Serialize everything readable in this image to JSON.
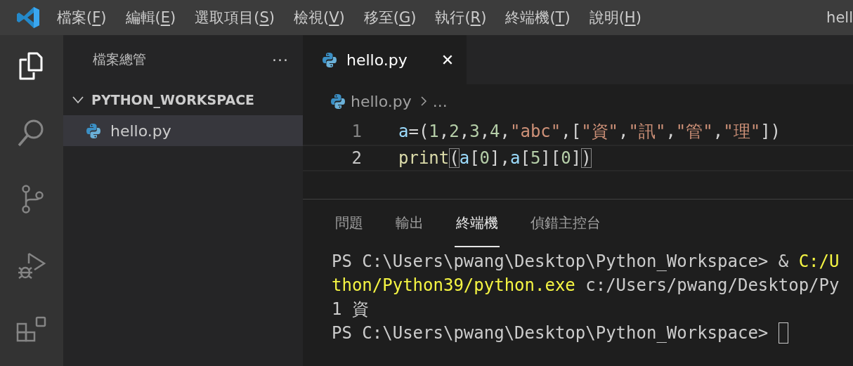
{
  "title_bar": {
    "menu": [
      {
        "before": "檔案(",
        "key": "F",
        "after": ")"
      },
      {
        "before": "編輯(",
        "key": "E",
        "after": ")"
      },
      {
        "before": "選取項目(",
        "key": "S",
        "after": ")"
      },
      {
        "before": "檢視(",
        "key": "V",
        "after": ")"
      },
      {
        "before": "移至(",
        "key": "G",
        "after": ")"
      },
      {
        "before": "執行(",
        "key": "R",
        "after": ")"
      },
      {
        "before": "終端機(",
        "key": "T",
        "after": ")"
      },
      {
        "before": "說明(",
        "key": "H",
        "after": ")"
      }
    ],
    "title": "hell"
  },
  "activity_bar": [
    {
      "kind": "files",
      "selected": true
    },
    {
      "kind": "search",
      "selected": false
    },
    {
      "kind": "source",
      "selected": false
    },
    {
      "kind": "debug",
      "selected": false
    },
    {
      "kind": "extensions",
      "selected": false
    }
  ],
  "sidebar": {
    "title": "檔案總管",
    "more": "···",
    "folder": {
      "name": "PYTHON_WORKSPACE",
      "expanded": true,
      "children": [
        {
          "name": "hello.py",
          "selected": true
        }
      ]
    }
  },
  "editor": {
    "tabs": [
      {
        "label": "hello.py",
        "close": "✕",
        "selected": true
      }
    ],
    "breadcrumb": {
      "file": "hello.py",
      "rest": "..."
    },
    "lines": [
      {
        "number": "1",
        "current": false,
        "tokens": [
          {
            "kind": "var",
            "text": "a"
          },
          {
            "kind": "punc",
            "text": "=("
          },
          {
            "kind": "num",
            "text": "1"
          },
          {
            "kind": "punc",
            "text": ","
          },
          {
            "kind": "num",
            "text": "2"
          },
          {
            "kind": "punc",
            "text": ","
          },
          {
            "kind": "num",
            "text": "3"
          },
          {
            "kind": "punc",
            "text": ","
          },
          {
            "kind": "num",
            "text": "4"
          },
          {
            "kind": "punc",
            "text": ","
          },
          {
            "kind": "str",
            "text": "\"abc\""
          },
          {
            "kind": "punc",
            "text": ",["
          },
          {
            "kind": "str",
            "text": "\"資\""
          },
          {
            "kind": "punc",
            "text": ","
          },
          {
            "kind": "str",
            "text": "\"訊\""
          },
          {
            "kind": "punc",
            "text": ","
          },
          {
            "kind": "str",
            "text": "\"管\""
          },
          {
            "kind": "punc",
            "text": ","
          },
          {
            "kind": "str",
            "text": "\"理\""
          },
          {
            "kind": "punc",
            "text": "])"
          }
        ]
      },
      {
        "number": "2",
        "current": true,
        "tokens": [
          {
            "kind": "fn",
            "text": "print"
          },
          {
            "kind": "match",
            "text": "("
          },
          {
            "kind": "var",
            "text": "a"
          },
          {
            "kind": "punc",
            "text": "["
          },
          {
            "kind": "num",
            "text": "0"
          },
          {
            "kind": "punc",
            "text": "],"
          },
          {
            "kind": "var",
            "text": "a"
          },
          {
            "kind": "punc",
            "text": "["
          },
          {
            "kind": "num",
            "text": "5"
          },
          {
            "kind": "punc",
            "text": "]["
          },
          {
            "kind": "num",
            "text": "0"
          },
          {
            "kind": "punc",
            "text": "]"
          },
          {
            "kind": "match",
            "text": ")"
          }
        ]
      }
    ]
  },
  "panel": {
    "tabs": [
      {
        "label": "問題",
        "selected": false
      },
      {
        "label": "輸出",
        "selected": false
      },
      {
        "label": "終端機",
        "selected": true
      },
      {
        "label": "偵錯主控台",
        "selected": false
      }
    ],
    "terminal": [
      {
        "segments": [
          {
            "kind": "plain",
            "text": "PS C:\\Users\\pwang\\Desktop\\Python_Workspace> & "
          },
          {
            "kind": "path",
            "text": "C:/U"
          }
        ]
      },
      {
        "segments": [
          {
            "kind": "path",
            "text": "thon/Python39/python.exe"
          },
          {
            "kind": "plain",
            "text": " c:/Users/pwang/Desktop/Py"
          }
        ]
      },
      {
        "segments": [
          {
            "kind": "plain",
            "text": "1 資"
          }
        ]
      },
      {
        "segments": [
          {
            "kind": "plain",
            "text": "PS C:\\Users\\pwang\\Desktop\\Python_Workspace> "
          }
        ],
        "cursor": true
      }
    ]
  }
}
